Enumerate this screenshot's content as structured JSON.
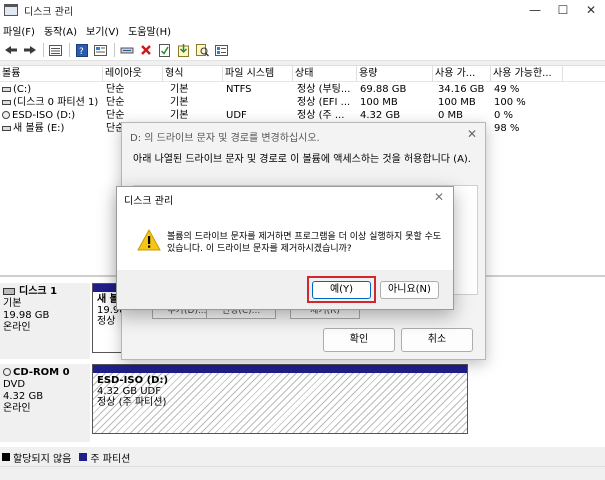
{
  "window": {
    "title": "디스크 관리",
    "controls": [
      "—",
      "☐",
      "✕"
    ]
  },
  "menu": [
    "파일(F)",
    "동작(A)",
    "보기(V)",
    "도움말(H)"
  ],
  "toolbar_icons": [
    "back-icon",
    "forward-icon",
    "list-icon",
    "help-icon",
    "properties-icon",
    "connect-icon",
    "delete-icon",
    "check-icon",
    "import-icon",
    "search-icon",
    "view-icon"
  ],
  "volumes": {
    "headers": [
      "볼륨",
      "레이아웃",
      "형식",
      "파일 시스템",
      "상태",
      "용량",
      "사용 가...",
      "사용 가능한..."
    ],
    "rows": [
      [
        "(C:)",
        "단순",
        "기본",
        "NTFS",
        "정상 (부팅...",
        "69.88 GB",
        "34.16 GB",
        "49 %"
      ],
      [
        "(디스크 0 파티션 1)",
        "단순",
        "기본",
        "",
        "정상 (EFI ...",
        "100 MB",
        "100 MB",
        "100 %"
      ],
      [
        "ESD-ISO (D:)",
        "단순",
        "기본",
        "UDF",
        "정상 (주 ...",
        "4.32 GB",
        "0 MB",
        "0 %"
      ],
      [
        "새 볼륨 (E:)",
        "단순",
        "기본",
        "",
        "",
        "",
        "",
        "98 %"
      ]
    ]
  },
  "disks": [
    {
      "name": "디스크 1",
      "type": "기본",
      "size": "19.98 GB",
      "status": "온라인",
      "partition": {
        "line1": "새 볼",
        "line2": "19.98",
        "line3": "정상"
      }
    },
    {
      "name": "CD-ROM 0",
      "type": "DVD",
      "size": "4.32 GB",
      "status": "온라인",
      "partition": {
        "line1": "ESD-ISO  (D:)",
        "line2": "4.32 GB UDF",
        "line3": "정상 (주 파티션)"
      }
    }
  ],
  "legend": {
    "unallocated": "할당되지 않음",
    "primary": "주 파티션",
    "colors": {
      "unallocated": "#000000",
      "primary": "#1f1f8c"
    }
  },
  "back_dialog": {
    "title": "D: 의 드라이브 문자 및 경로를 변경하십시오.",
    "description": "아래 나열된 드라이브 문자 및 경로로 이 볼륨에 액세스하는 것을 허용합니다 (A).",
    "ghost_buttons": [
      "추가(D)...",
      "변경(C)...",
      "제거(R)"
    ],
    "ok": "확인",
    "cancel": "취소"
  },
  "front_dialog": {
    "title": "디스크 관리",
    "message": "볼륨의 드라이브 문자를 제거하면 프로그램을 더 이상 실행하지 못할 수도 있습니다. 이 드라이브 문자를 제거하시겠습니까?",
    "yes": "예(Y)",
    "no": "아니요(N)"
  }
}
